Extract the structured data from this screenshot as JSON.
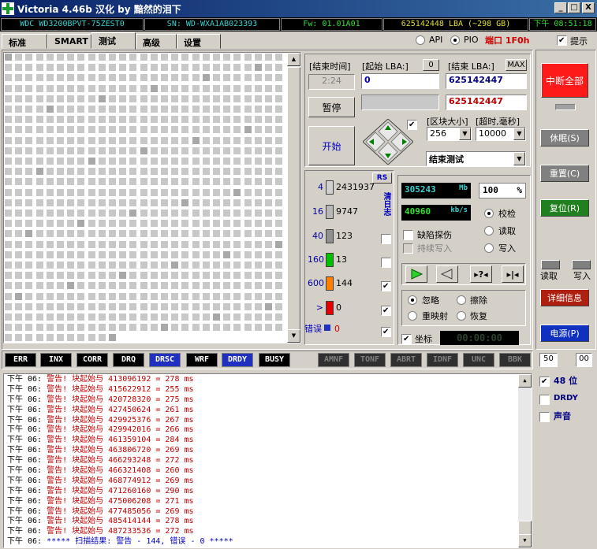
{
  "window": {
    "title": "Victoria 4.46b 汉化 by 黯然的泪下",
    "minimize": "_",
    "maximize": "□",
    "close": "X"
  },
  "infobar": {
    "model": "WDC WD3200BPVT-75ZEST0",
    "serial": "SN: WD-WXA1AB023393",
    "firmware": "Fw: 01.01A01",
    "capacity": "625142448 LBA (~298 GB)",
    "time": "下午 08:51:18"
  },
  "tabs": [
    "标准",
    "SMART",
    "测试",
    "高级",
    "设置"
  ],
  "active_tab": 2,
  "mode": {
    "api_label": "API",
    "pio_label": "PIO",
    "port_label": "端口 1F0h",
    "hint_label": "提示"
  },
  "test": {
    "end_time_label": "[结束时间]",
    "end_time_value": "2:24",
    "start_lba_label": "[起始 LBA:]",
    "start_lba_button": "0",
    "start_lba_value": "0",
    "end_lba_label": "[结束 LBA:]",
    "end_lba_max": "MAX",
    "end_lba_value": "625142447",
    "current_lba_value": "625142447",
    "pause_label": "暂停",
    "start_label": "开始",
    "block_size_label": "[区块大小]",
    "block_size_value": "256",
    "timeout_label": "[超时,毫秒]",
    "timeout_value": "10000",
    "action_value": "结束测试"
  },
  "blocks": {
    "rs_label": "RS",
    "vertical_label": "清日志",
    "rows": [
      {
        "threshold": "4",
        "count": "2431937",
        "color": "#d0d0d0"
      },
      {
        "threshold": "16",
        "count": "9747",
        "color": "#b8b8b8"
      },
      {
        "threshold": "40",
        "count": "123",
        "color": "#909090"
      },
      {
        "threshold": "160",
        "count": "13",
        "color": "#00c000"
      },
      {
        "threshold": "600",
        "count": "144",
        "color": "#ff8000"
      },
      {
        "threshold": ">",
        "count": "0",
        "color": "#e00000"
      }
    ],
    "error_label": "错误",
    "error_count": "0"
  },
  "stats": {
    "mb_value": "305243",
    "mb_unit": "Mb",
    "percent_value": "100",
    "percent_unit": "%",
    "speed_value": "40960",
    "speed_unit": "kb/s",
    "verify_label": "校检",
    "read_label": "读取",
    "write_label": "写入",
    "defect_label": "缺陷探伤",
    "continuous_write_label": "持续写入",
    "ignore_label": "忽略",
    "erase_label": "擦除",
    "remap_label": "重映射",
    "restore_label": "恢复",
    "coords_label": "坐标",
    "coords_value": "00:00:00"
  },
  "right_panel": {
    "stop_all": "中断全部",
    "sleep": "休眠(S)",
    "reset": "重置(C)",
    "recall": "复位(R)",
    "read_label": "读取",
    "write_label": "写入",
    "details": "详细信息",
    "power": "电源(P)",
    "counter_a": "50",
    "counter_b": "00"
  },
  "status_lights": [
    "ERR",
    "INX",
    "CORR",
    "DRQ",
    "DRSC",
    "WRF",
    "DRDY",
    "BUSY",
    "AMNF",
    "TONF",
    "ABRT",
    "IDNF",
    "UNC",
    "BBK"
  ],
  "log_options": {
    "bits48": "48 位",
    "drdy": "DRDY",
    "sound": "声音"
  },
  "log": [
    {
      "time": "下午 06:",
      "msg": "警告! 块起始与 413096192 = 278 ms"
    },
    {
      "time": "下午 06:",
      "msg": "警告! 块起始与 415622912 = 255 ms"
    },
    {
      "time": "下午 06:",
      "msg": "警告! 块起始与 420728320 = 275 ms"
    },
    {
      "time": "下午 06:",
      "msg": "警告! 块起始与 427450624 = 261 ms"
    },
    {
      "time": "下午 06:",
      "msg": "警告! 块起始与 429925376 = 267 ms"
    },
    {
      "time": "下午 06:",
      "msg": "警告! 块起始与 429942016 = 266 ms"
    },
    {
      "time": "下午 06:",
      "msg": "警告! 块起始与 461359104 = 284 ms"
    },
    {
      "time": "下午 06:",
      "msg": "警告! 块起始与 463806720 = 269 ms"
    },
    {
      "time": "下午 06:",
      "msg": "警告! 块起始与 466293248 = 272 ms"
    },
    {
      "time": "下午 06:",
      "msg": "警告! 块起始与 466321408 = 260 ms"
    },
    {
      "time": "下午 06:",
      "msg": "警告! 块起始与 468774912 = 269 ms"
    },
    {
      "time": "下午 06:",
      "msg": "警告! 块起始与 471260160 = 290 ms"
    },
    {
      "time": "下午 06:",
      "msg": "警告! 块起始与 475006208 = 271 ms"
    },
    {
      "time": "下午 06:",
      "msg": "警告! 块起始与 477485056 = 269 ms"
    },
    {
      "time": "下午 06:",
      "msg": "警告! 块起始与 485414144 = 278 ms"
    },
    {
      "time": "下午 06:",
      "msg": "警告! 块起始与 487233536 = 272 ms"
    },
    {
      "time": "下午 06:",
      "msg": "***** 扫描结果: 警告 - 144, 错误 - 0 *****"
    }
  ]
}
